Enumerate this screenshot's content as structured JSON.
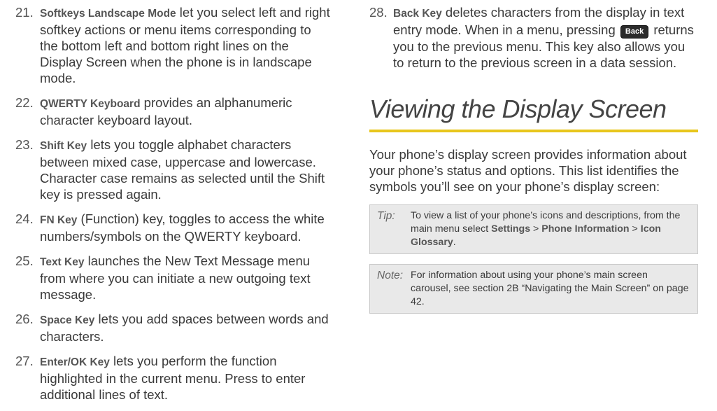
{
  "left_items": [
    {
      "num": "21.",
      "title": "Softkeys Landscape Mode",
      "text": " let you select left and right softkey actions or menu items corresponding to the bottom left and bottom right lines on the Display Screen when the phone is in landscape mode."
    },
    {
      "num": "22.",
      "title": "QWERTY Keyboard",
      "text": " provides an alphanumeric character keyboard layout."
    },
    {
      "num": "23.",
      "title": "Shift Key",
      "text": " lets you toggle alphabet characters between mixed case, uppercase and lowercase. Character case remains as selected until the Shift key is pressed again."
    },
    {
      "num": "24.",
      "title": "FN Key",
      "text": " (Function) key, toggles to access the white numbers/symbols on the QWERTY keyboard."
    },
    {
      "num": "25.",
      "title": "Text Key",
      "text": " launches the New Text Message menu from where you can initiate a new outgoing text message."
    },
    {
      "num": "26.",
      "title": "Space Key",
      "text": " lets you add spaces between words and characters."
    },
    {
      "num": "27.",
      "title": "Enter/OK Key",
      "text": " lets you perform the function highlighted in the current menu. Press to enter additional lines of text."
    }
  ],
  "item28": {
    "num": "28.",
    "title": "Back Key",
    "text_before": " deletes characters from the display in text entry mode. When in a menu, pressing ",
    "key_label": "Back",
    "text_after": " returns you to the previous menu. This key also allows you to return to the previous screen in a data session."
  },
  "section_title": "Viewing the Display Screen",
  "intro": "Your phone’s display screen provides information about your phone’s status and options. This list identifies the symbols you’ll see on your phone’s display screen:",
  "tip": {
    "label": "Tip:",
    "text1": "To view a list of your phone’s icons and descriptions, from the main menu select ",
    "b1": "Settings",
    "sep1": " > ",
    "b2": "Phone Information",
    "sep2": " > ",
    "b3": "Icon Glossary",
    "end": "."
  },
  "note": {
    "label": "Note:",
    "text": "For information about using your phone’s main screen carousel, see section 2B “Navigating the Main Screen” on page 42."
  },
  "colors": {
    "accent_rule": "#e8c61c",
    "box_bg": "#e9e9e9"
  }
}
